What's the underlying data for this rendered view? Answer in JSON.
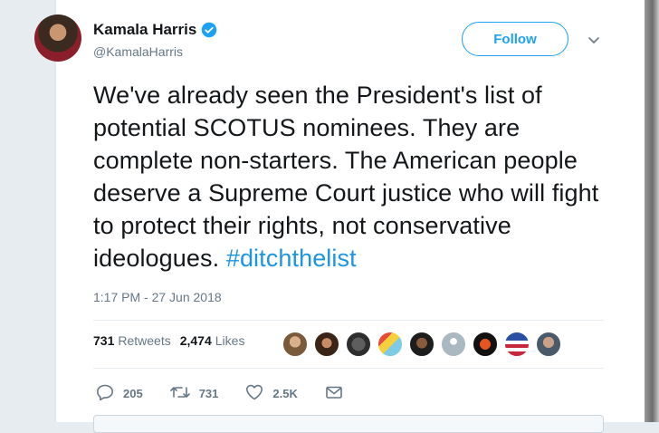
{
  "tweet": {
    "author_name": "Kamala Harris",
    "author_handle": "@KamalaHarris",
    "follow_label": "Follow",
    "text": "We've already seen the President's list of potential SCOTUS nominees. They are complete non-starters. The American people deserve a Supreme Court justice who will fight to protect their rights, not conservative ideologues. ",
    "hashtag": "#ditchthelist",
    "timestamp": "1:17 PM - 27 Jun 2018"
  },
  "stats": {
    "retweets_count": "731",
    "retweets_label": "Retweets",
    "likes_count": "2,474",
    "likes_label": "Likes"
  },
  "actions": {
    "replies": "205",
    "retweets": "731",
    "likes": "2.5K"
  },
  "colors": {
    "accent": "#1da1f2",
    "hashtag": "#1b95e0",
    "muted": "#657786"
  },
  "icons": [
    "verified-badge-icon",
    "chevron-down-icon",
    "reply-icon",
    "retweet-icon",
    "heart-icon",
    "message-icon"
  ]
}
